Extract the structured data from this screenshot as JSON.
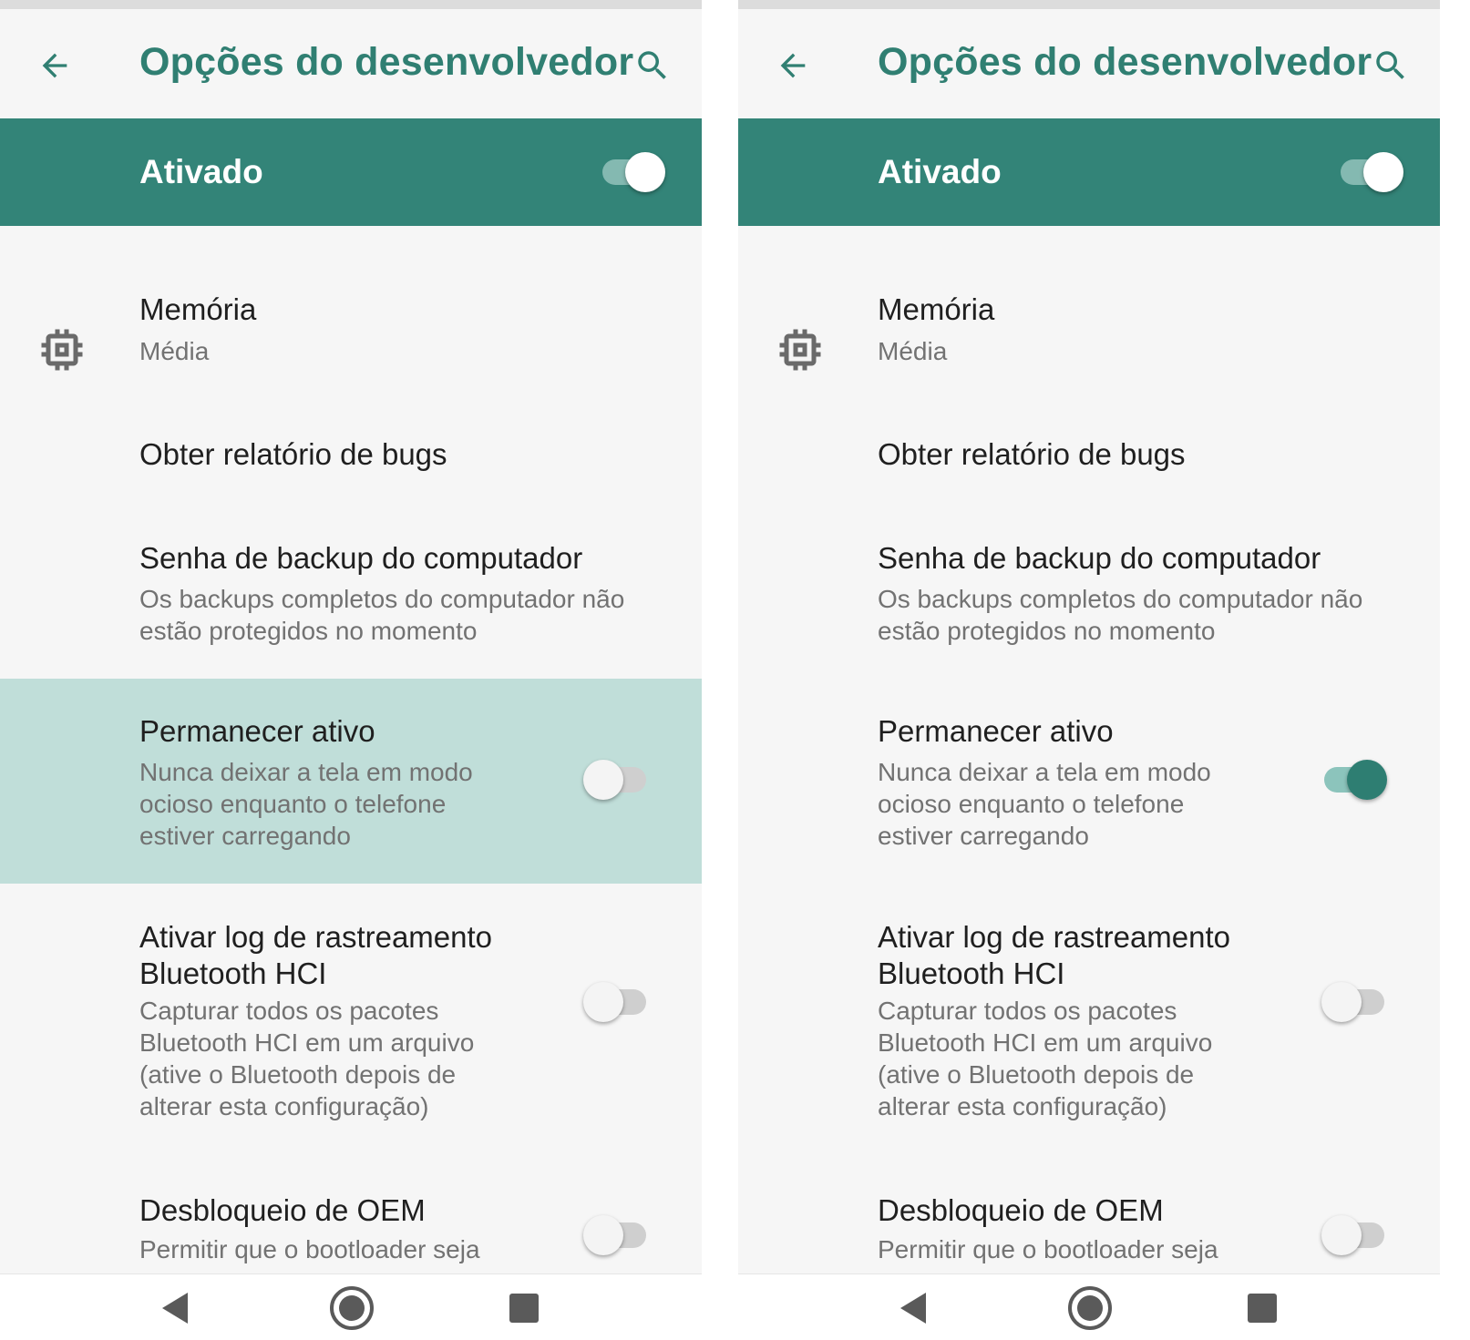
{
  "screens": [
    {
      "title": "Opções do desenvolvedor",
      "master": {
        "label": "Ativado",
        "on": true
      },
      "items": [
        {
          "title": "Memória",
          "summary": "Média",
          "icon": "memory-chip-icon"
        },
        {
          "title": "Obter relatório de bugs"
        },
        {
          "title": "Senha de backup do computador",
          "summary": "Os backups completos do computador não estão protegidos no momento"
        },
        {
          "title": "Permanecer ativo",
          "summary": "Nunca deixar a tela em modo ocioso enquanto o telefone estiver carregando",
          "switch_on": false,
          "highlighted": true
        },
        {
          "title": "Ativar log de rastreamento Bluetooth HCI",
          "summary": "Capturar todos os pacotes Bluetooth HCI em um arquivo (ative o Bluetooth depois de alterar esta configuração)",
          "switch_on": false
        },
        {
          "title": "Desbloqueio de OEM",
          "summary": "Permitir que o bootloader seja",
          "switch_on": false
        }
      ]
    },
    {
      "title": "Opções do desenvolvedor",
      "master": {
        "label": "Ativado",
        "on": true
      },
      "items": [
        {
          "title": "Memória",
          "summary": "Média",
          "icon": "memory-chip-icon"
        },
        {
          "title": "Obter relatório de bugs"
        },
        {
          "title": "Senha de backup do computador",
          "summary": "Os backups completos do computador não estão protegidos no momento"
        },
        {
          "title": "Permanecer ativo",
          "summary": "Nunca deixar a tela em modo ocioso enquanto o telefone estiver carregando",
          "switch_on": true,
          "highlighted": false
        },
        {
          "title": "Ativar log de rastreamento Bluetooth HCI",
          "summary": "Capturar todos os pacotes Bluetooth HCI em um arquivo (ative o Bluetooth depois de alterar esta configuração)",
          "switch_on": false
        },
        {
          "title": "Desbloqueio de OEM",
          "summary": "Permitir que o bootloader seja",
          "switch_on": false
        }
      ]
    }
  ],
  "navbar": {
    "icons": [
      "back-triangle-icon",
      "home-circle-icon",
      "recents-square-icon"
    ]
  },
  "colors": {
    "accent": "#307f72",
    "header": "#338478",
    "highlight": "#c0ded9",
    "switch_on": "#2e7e72"
  }
}
